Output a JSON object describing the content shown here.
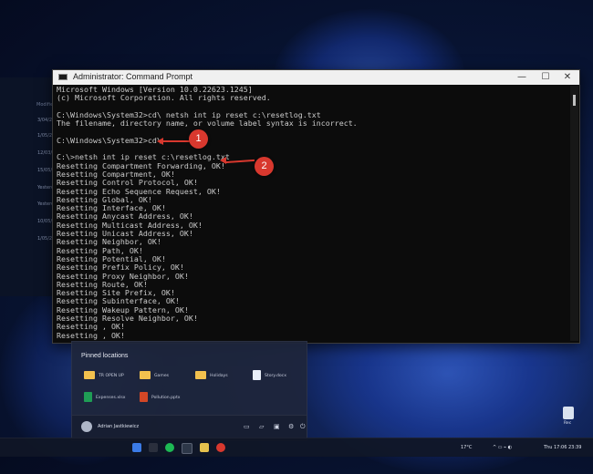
{
  "background": {
    "explorer_column_header": "Modified",
    "dates": [
      "3/04/202",
      "1/05/202",
      "12/03/202",
      "15/05/202",
      "Yesterday",
      "Yesterday",
      "10/05/202",
      "1/05/202"
    ]
  },
  "window": {
    "title": "Administrator: Command Prompt",
    "buttons": {
      "minimize": "—",
      "maximize": "☐",
      "close": "✕"
    }
  },
  "terminal": {
    "lines": [
      "Microsoft Windows [Version 10.0.22623.1245]",
      "(c) Microsoft Corporation. All rights reserved.",
      "",
      "C:\\Windows\\System32>cd\\ netsh int ip reset c:\\resetlog.txt",
      "The filename, directory name, or volume label syntax is incorrect.",
      "",
      "C:\\Windows\\System32>cd\\",
      "",
      "C:\\>netsh int ip reset c:\\resetlog.txt",
      "Resetting Compartment Forwarding, OK!",
      "Resetting Compartment, OK!",
      "Resetting Control Protocol, OK!",
      "Resetting Echo Sequence Request, OK!",
      "Resetting Global, OK!",
      "Resetting Interface, OK!",
      "Resetting Anycast Address, OK!",
      "Resetting Multicast Address, OK!",
      "Resetting Unicast Address, OK!",
      "Resetting Neighbor, OK!",
      "Resetting Path, OK!",
      "Resetting Potential, OK!",
      "Resetting Prefix Policy, OK!",
      "Resetting Proxy Neighbor, OK!",
      "Resetting Route, OK!",
      "Resetting Site Prefix, OK!",
      "Resetting Subinterface, OK!",
      "Resetting Wakeup Pattern, OK!",
      "Resetting Resolve Neighbor, OK!",
      "Resetting , OK!",
      "Resetting , OK!"
    ]
  },
  "annotations": {
    "marker1": "1",
    "marker2": "2",
    "color": "#d8382e"
  },
  "start_menu": {
    "pinned_heading": "Pinned locations",
    "items": [
      "TR OPEN UP",
      "Games",
      "Holidays",
      "Story.docx",
      "Expenses.xlsx",
      "Pollution.pptx"
    ],
    "user_name": "Adrian Jastkiewicz"
  },
  "desktop": {
    "recycle_bin_label": "Rec"
  },
  "tray": {
    "weather": "17°C",
    "time": "Thu 17:06 23:39"
  }
}
